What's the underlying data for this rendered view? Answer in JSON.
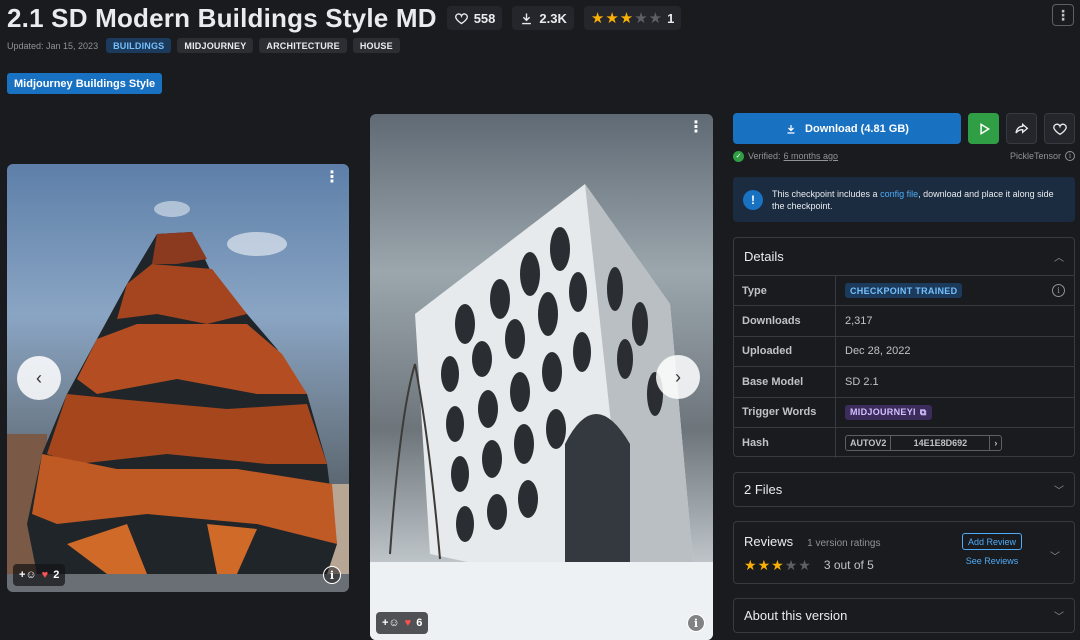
{
  "header": {
    "title": "2.1 SD Modern Buildings Style MD",
    "likes": "558",
    "downloads": "2.3K",
    "rating_count": "1",
    "rating_stars": 3,
    "updated": "Updated: Jan 15, 2023",
    "tags": [
      "BUILDINGS",
      "MIDJOURNEY",
      "ARCHITECTURE",
      "HOUSE"
    ],
    "badge": "Midjourney Buildings Style"
  },
  "gallery": [
    {
      "reactions": "2",
      "kind": "organic-facade-building"
    },
    {
      "reactions": "6",
      "kind": "perforated-white-building"
    }
  ],
  "actions": {
    "download_label": "Download (4.81 GB)"
  },
  "verification": {
    "label": "Verified:",
    "ago": "6 months ago",
    "author": "PickleTensor"
  },
  "notice": {
    "before": "This checkpoint includes a ",
    "link": "config file",
    "after": ", download and place it along side the checkpoint."
  },
  "details": {
    "title": "Details",
    "rows": {
      "type_label": "Type",
      "type_value": "CHECKPOINT TRAINED",
      "downloads_label": "Downloads",
      "downloads_value": "2,317",
      "uploaded_label": "Uploaded",
      "uploaded_value": "Dec 28, 2022",
      "base_model_label": "Base Model",
      "base_model_value": "SD 2.1",
      "trigger_label": "Trigger Words",
      "trigger_value": "MIDJOURNEYI",
      "hash_label": "Hash",
      "hash_type": "AUTOV2",
      "hash_value": "14E1E8D692"
    }
  },
  "files": {
    "title": "2 Files"
  },
  "reviews": {
    "title": "Reviews",
    "count": "1 version ratings",
    "stars": 3,
    "out_of": "3 out of 5",
    "add_label": "Add Review",
    "see_label": "See Reviews"
  },
  "about": {
    "title": "About this version"
  },
  "colors": {
    "background": "#1a1b1e",
    "primary": "#1971c2",
    "green": "#2f9e44",
    "star": "#fab005"
  }
}
